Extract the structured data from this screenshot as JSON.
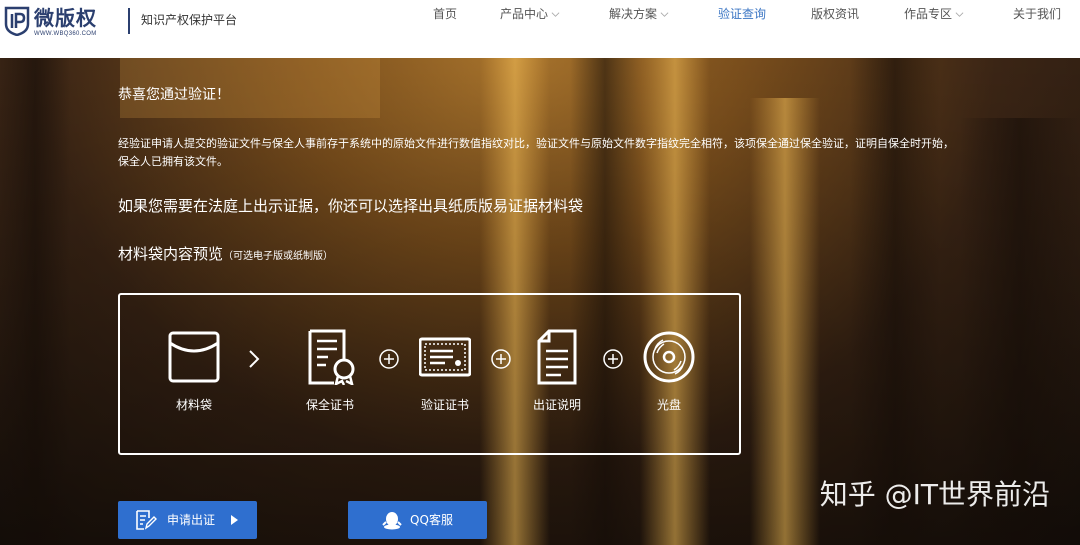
{
  "header": {
    "logo_name": "微版权",
    "logo_url": "WWW.WBQ360.COM",
    "slogan": "知识产权保护平台"
  },
  "nav": {
    "items": [
      {
        "label": "首页",
        "dropdown": false,
        "active": false
      },
      {
        "label": "产品中心",
        "dropdown": true,
        "active": false
      },
      {
        "label": "解决方案",
        "dropdown": true,
        "active": false
      },
      {
        "label": "验证查询",
        "dropdown": false,
        "active": true
      },
      {
        "label": "版权资讯",
        "dropdown": false,
        "active": false
      },
      {
        "label": "作品专区",
        "dropdown": true,
        "active": false
      },
      {
        "label": "关于我们",
        "dropdown": false,
        "active": false
      }
    ],
    "active_color": "#3b76c4"
  },
  "hero": {
    "congrats": "恭喜您通过验证！",
    "description": "经验证申请人提交的验证文件与保全人事前存于系统中的原始文件进行数值指纹对比，验证文件与原始文件数字指纹完全相符，该项保全通过保全验证，证明自保全时开始，保全人已拥有该文件。",
    "court_text": "如果您需要在法庭上出示证据，你还可以选择出具纸质版易证据材料袋",
    "preview_title": "材料袋内容预览",
    "preview_note": "（可选电子版或纸制版）",
    "bag_items": [
      {
        "label": "材料袋",
        "icon": "envelope-icon"
      },
      {
        "label": "保全证书",
        "icon": "certificate-icon"
      },
      {
        "label": "验证证书",
        "icon": "verify-certificate-icon"
      },
      {
        "label": "出证说明",
        "icon": "document-icon"
      },
      {
        "label": "光盘",
        "icon": "disc-icon"
      }
    ],
    "separators": [
      ">",
      "+",
      "+",
      "+"
    ]
  },
  "buttons": {
    "apply_label": "申请出证",
    "qq_label": "QQ客服",
    "color": "#2f6fcf"
  },
  "watermark": "知乎 @IT世界前沿"
}
